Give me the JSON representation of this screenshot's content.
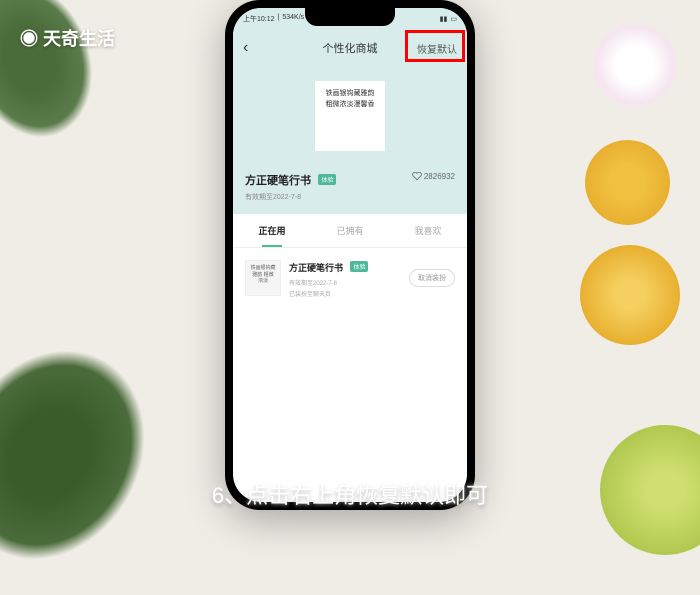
{
  "watermark": "天奇生活",
  "caption": "6、点击右上角恢复默认即可",
  "status": {
    "time": "上午10:12",
    "speed": "534K/s",
    "signal_icon": "signal-icon",
    "battery_icon": "battery-icon"
  },
  "header": {
    "back_icon": "‹",
    "title": "个性化商城",
    "restore": "恢复默认"
  },
  "preview": {
    "sample_text": "铁画银钩藏雅韵 粗微浓淡漫馨香"
  },
  "font": {
    "name": "方正硬笔行书",
    "badge": "体验",
    "expiry": "有效期至2022-7-8",
    "likes": "2826932"
  },
  "tabs": [
    {
      "label": "正在用",
      "active": true
    },
    {
      "label": "已拥有",
      "active": false
    },
    {
      "label": "我喜欢",
      "active": false
    }
  ],
  "list": [
    {
      "thumb_text": "铁画银钩藏雅韵 粗微浓淡",
      "name": "方正硬笔行书",
      "badge": "体验",
      "sub1": "有效期至2022-7-8",
      "sub2": "已装扮至聊天页",
      "action": "取消装扮"
    }
  ]
}
